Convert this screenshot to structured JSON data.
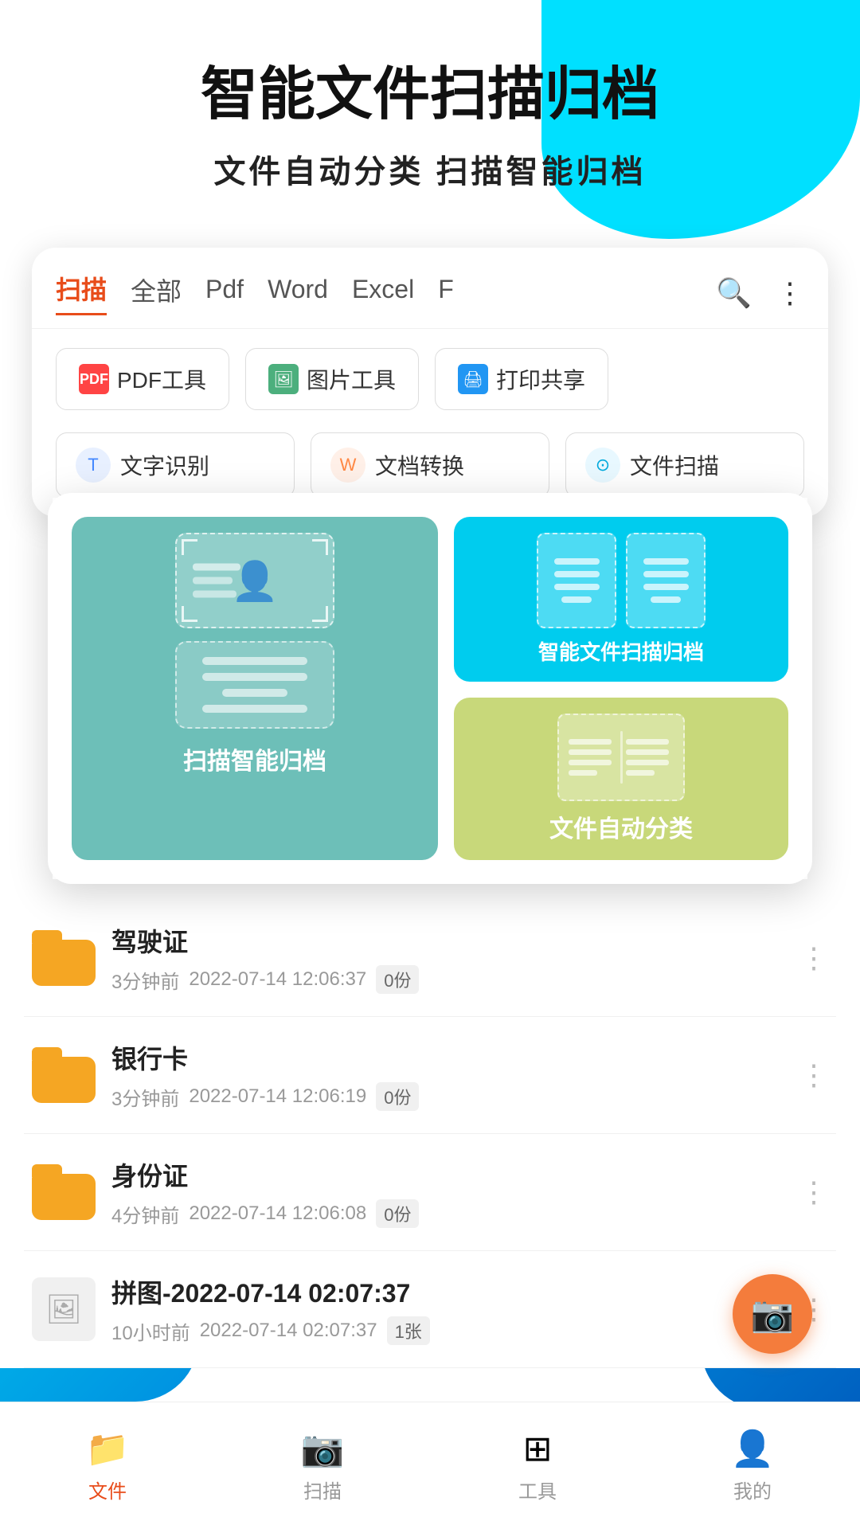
{
  "hero": {
    "title": "智能文件扫描归档",
    "subtitle": "文件自动分类  扫描智能归档"
  },
  "tabs": {
    "items": [
      {
        "label": "扫描",
        "active": true
      },
      {
        "label": "全部",
        "active": false
      },
      {
        "label": "Pdf",
        "active": false
      },
      {
        "label": "Word",
        "active": false
      },
      {
        "label": "Excel",
        "active": false
      },
      {
        "label": "F",
        "active": false
      }
    ]
  },
  "tools": [
    {
      "icon": "PDF",
      "label": "PDF工具"
    },
    {
      "icon": "IMG",
      "label": "图片工具"
    },
    {
      "icon": "PRN",
      "label": "打印共享"
    }
  ],
  "features": [
    {
      "icon": "T",
      "label": "文字识别"
    },
    {
      "icon": "W",
      "label": "文档转换"
    },
    {
      "icon": "SCAN",
      "label": "文件扫描"
    }
  ],
  "overlay": {
    "left_label": "扫描智能归档",
    "top_right_label": "智能文件扫描归档",
    "bottom_right_label": "文件自动分类"
  },
  "files": [
    {
      "type": "folder",
      "name": "驾驶证",
      "time": "3分钟前",
      "date": "2022-07-14 12:06:37",
      "count": "0份"
    },
    {
      "type": "folder",
      "name": "银行卡",
      "time": "3分钟前",
      "date": "2022-07-14 12:06:19",
      "count": "0份"
    },
    {
      "type": "folder",
      "name": "身份证",
      "time": "4分钟前",
      "date": "2022-07-14 12:06:08",
      "count": "0份"
    },
    {
      "type": "image",
      "name": "拼图-2022-07-14 02:07:37",
      "time": "10小时前",
      "date": "2022-07-14 02:07:37",
      "count": "1张"
    }
  ],
  "bottom_nav": [
    {
      "icon": "📁",
      "label": "文件",
      "active": true
    },
    {
      "icon": "📷",
      "label": "扫描",
      "active": false
    },
    {
      "icon": "⊞",
      "label": "工具",
      "active": false
    },
    {
      "icon": "👤",
      "label": "我的",
      "active": false
    }
  ]
}
